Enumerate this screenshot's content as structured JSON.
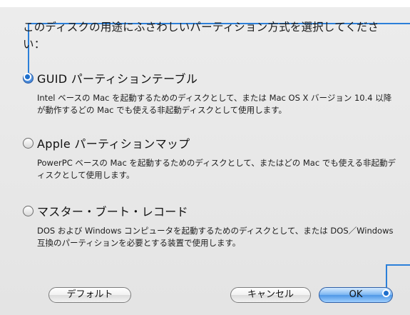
{
  "dialog": {
    "prompt": "このディスクの用途にふさわしいパーティション方式を選択してください：",
    "options": [
      {
        "label": "GUID パーティションテーブル",
        "selected": true,
        "description": "Intel ベースの Mac を起動するためのディスクとして、または Mac OS X バージョン 10.4 以降が動作するどの Mac でも使える非起動ディスクとして使用します。"
      },
      {
        "label": "Apple パーティションマップ",
        "selected": false,
        "description": "PowerPC ベースの Mac を起動するためのディスクとして、またはどの Mac でも使える非起動ディスクとして使用します。"
      },
      {
        "label": "マスター・ブート・レコード",
        "selected": false,
        "description": "DOS および Windows コンピュータを起動するためのディスクとして、または DOS／Windows 互換のパーティションを必要とする装置で使用します。"
      }
    ]
  },
  "buttons": {
    "default_label": "デフォルト",
    "cancel_label": "キャンセル",
    "ok_label": "OK"
  },
  "colors": {
    "callout": "#1e6fcc",
    "primary_button": "#5d9ee8"
  }
}
